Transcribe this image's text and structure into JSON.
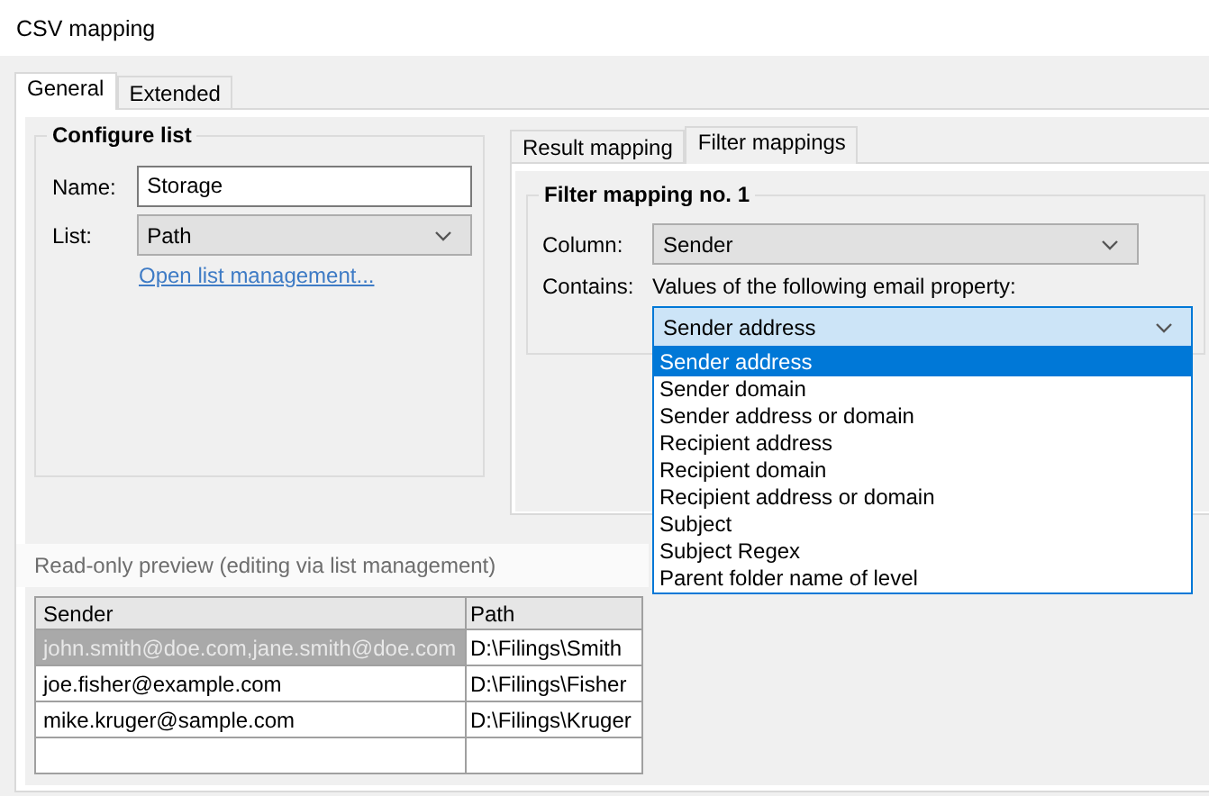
{
  "window": {
    "title": "CSV mapping"
  },
  "tabs": [
    {
      "label": "General",
      "selected": true
    },
    {
      "label": "Extended",
      "selected": false
    }
  ],
  "configure_list": {
    "title": "Configure list",
    "name_label": "Name:",
    "name_value": "Storage",
    "list_label": "List:",
    "list_value": "Path",
    "link": "Open list management..."
  },
  "mapping_tabs": [
    {
      "label": "Result mapping",
      "selected": false
    },
    {
      "label": "Filter mappings",
      "selected": true
    }
  ],
  "filter_mapping": {
    "title": "Filter mapping no. 1",
    "column_label": "Column:",
    "column_value": "Sender",
    "contains_label": "Contains:",
    "contains_text": "Values of the following email property:",
    "property_value": "Sender address",
    "expanded": true,
    "options": [
      {
        "label": "Sender address",
        "selected": true
      },
      {
        "label": "Sender domain",
        "selected": false
      },
      {
        "label": "Sender address or domain",
        "selected": false
      },
      {
        "label": "Recipient address",
        "selected": false
      },
      {
        "label": "Recipient domain",
        "selected": false
      },
      {
        "label": "Recipient address or domain",
        "selected": false
      },
      {
        "label": "Subject",
        "selected": false
      },
      {
        "label": "Subject Regex",
        "selected": false
      },
      {
        "label": "Parent folder name of level",
        "selected": false
      }
    ]
  },
  "preview": {
    "title": "Read-only preview (editing via list management)",
    "columns": [
      "Sender",
      "Path"
    ],
    "rows": [
      {
        "cells": [
          "john.smith@doe.com,jane.smith@doe.com",
          "D:\\Filings\\Smith"
        ],
        "selected": true
      },
      {
        "cells": [
          "joe.fisher@example.com",
          "D:\\Filings\\Fisher"
        ],
        "selected": false
      },
      {
        "cells": [
          "mike.kruger@sample.com",
          "D:\\Filings\\Kruger"
        ],
        "selected": false
      }
    ]
  }
}
